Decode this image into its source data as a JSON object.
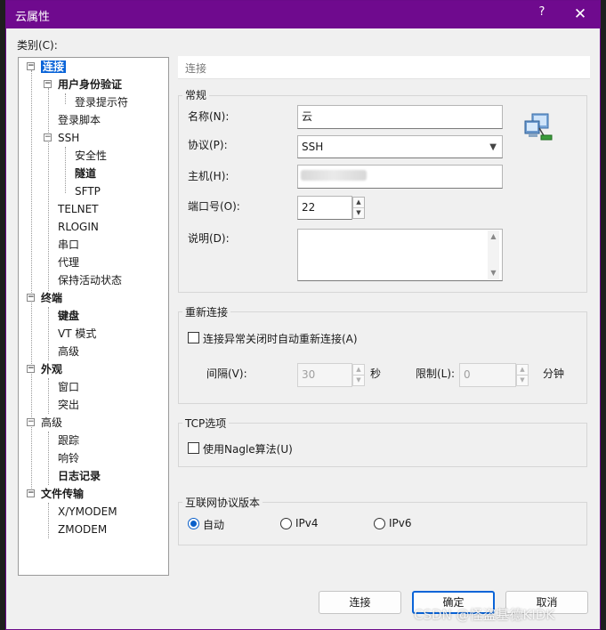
{
  "window": {
    "title": "云属性",
    "help": "?",
    "close": "✕"
  },
  "category_label": "类别(C):",
  "tree": [
    {
      "label": "连接",
      "bold": true,
      "selected": true
    },
    {
      "label": "用户身份验证",
      "bold": true
    },
    {
      "label": "登录提示符"
    },
    {
      "label": "登录脚本"
    },
    {
      "label": "SSH"
    },
    {
      "label": "安全性"
    },
    {
      "label": "隧道",
      "bold": true
    },
    {
      "label": "SFTP"
    },
    {
      "label": "TELNET"
    },
    {
      "label": "RLOGIN"
    },
    {
      "label": "串口"
    },
    {
      "label": "代理"
    },
    {
      "label": "保持活动状态"
    },
    {
      "label": "终端",
      "bold": true
    },
    {
      "label": "键盘",
      "bold": true
    },
    {
      "label": "VT 模式"
    },
    {
      "label": "高级"
    },
    {
      "label": "外观",
      "bold": true
    },
    {
      "label": "窗口"
    },
    {
      "label": "突出"
    },
    {
      "label": "高级"
    },
    {
      "label": "跟踪"
    },
    {
      "label": "响铃"
    },
    {
      "label": "日志记录",
      "bold": true
    },
    {
      "label": "文件传输",
      "bold": true
    },
    {
      "label": "X/YMODEM"
    },
    {
      "label": "ZMODEM"
    }
  ],
  "panel": {
    "header": "连接",
    "general": {
      "title": "常规",
      "name_label": "名称(N):",
      "name_value": "云",
      "protocol_label": "协议(P):",
      "protocol_value": "SSH",
      "host_label": "主机(H):",
      "host_value": "",
      "port_label": "端口号(O):",
      "port_value": "22",
      "desc_label": "说明(D):",
      "desc_value": ""
    },
    "reconnect": {
      "title": "重新连接",
      "checkbox_label": "连接异常关闭时自动重新连接(A)",
      "interval_label": "间隔(V):",
      "interval_value": "30",
      "interval_unit": "秒",
      "limit_label": "限制(L):",
      "limit_value": "0",
      "limit_unit": "分钟"
    },
    "tcp": {
      "title": "TCP选项",
      "nagle_label": "使用Nagle算法(U)"
    },
    "ipver": {
      "title": "互联网协议版本",
      "auto": "自动",
      "ipv4": "IPv4",
      "ipv6": "IPv6"
    }
  },
  "buttons": {
    "connect": "连接",
    "ok": "确定",
    "cancel": "取消"
  },
  "watermark": "CSDN @怪盗基德KIDK",
  "colors": {
    "titlebar": "#6f0a8e",
    "accent": "#0a64d8"
  }
}
